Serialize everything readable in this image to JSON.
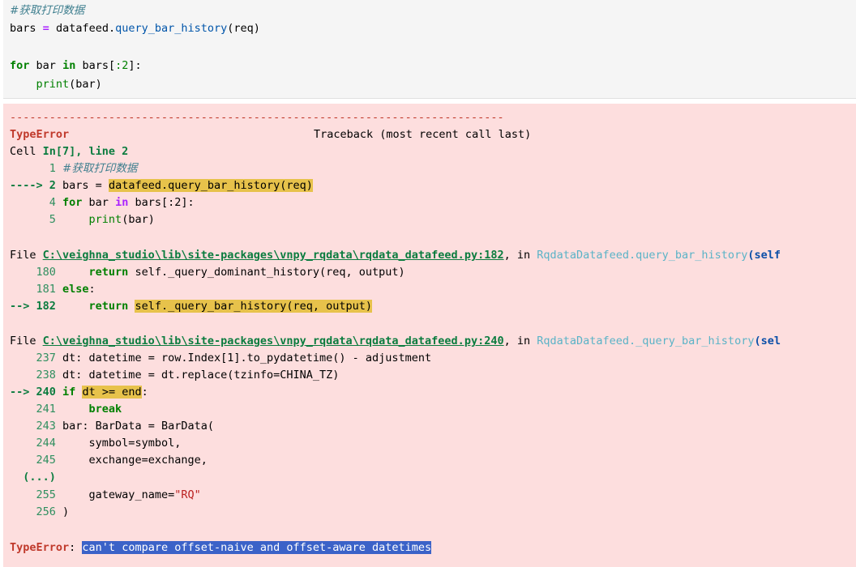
{
  "code_cell": {
    "comment": "#获取打印数据",
    "line2": {
      "var": "bars",
      "eq": "=",
      "obj": "datafeed",
      "method": "query_bar_history",
      "args": "(req)"
    },
    "line4": {
      "kw_for": "for",
      "var": "bar",
      "kw_in": "in",
      "iter": "bars",
      "slice_open": "[",
      "slice_num": ":2",
      "slice_close": "]",
      "colon": ":"
    },
    "line5": {
      "indent": "    ",
      "fn": "print",
      "args": "(bar)"
    }
  },
  "traceback": {
    "dashes": "---------------------------------------------------------------------------",
    "error_name": "TypeError",
    "traceback_label": "Traceback (most recent call last)",
    "cell_prefix": "Cell ",
    "cell_ref": "In[7], line 2",
    "frame1": [
      {
        "marker": "      1",
        "pre": " ",
        "comment": "#获取打印数据"
      },
      {
        "marker": "----> 2",
        "pre": " bars = ",
        "hl": "datafeed.query_bar_history(req)"
      },
      {
        "marker": "      4",
        "kw_for": " for",
        "mid": " bar ",
        "kw_in": "in",
        "post": " bars[:2]:"
      },
      {
        "marker": "      5",
        "fn": "     print",
        "post": "(bar)"
      }
    ],
    "file1": {
      "prefix": "File ",
      "path": "C:\\veighna_studio\\lib\\site-packages\\vnpy_rqdata\\rqdata_datafeed.py:182",
      "in": ", in ",
      "func": "RqdataDatafeed.query_bar_history",
      "paren": "(",
      "self": "self"
    },
    "frame2": [
      {
        "marker": "    180",
        "kw": "     return",
        "post": " self._query_dominant_history(req, output)"
      },
      {
        "marker": "    181",
        "kw": " else",
        "post": ":"
      },
      {
        "marker": "--> 182",
        "kw": "     return",
        "hl": "self._query_bar_history(req, output)"
      }
    ],
    "file2": {
      "prefix": "File ",
      "path": "C:\\veighna_studio\\lib\\site-packages\\vnpy_rqdata\\rqdata_datafeed.py:240",
      "in": ", in ",
      "func": "RqdataDatafeed._query_bar_history",
      "paren": "(",
      "self": "sel"
    },
    "frame3": [
      {
        "marker": "    237",
        "post": " dt: datetime = row.Index[1].to_pydatetime() - adjustment"
      },
      {
        "marker": "    238",
        "post": " dt: datetime = dt.replace(tzinfo=CHINA_TZ)"
      },
      {
        "marker": "--> 240",
        "kw": " if",
        "hl": "dt >= end",
        "post": ":"
      },
      {
        "marker": "    241",
        "kw": "     break",
        "post": ""
      },
      {
        "marker": "    243",
        "post": " bar: BarData = BarData("
      },
      {
        "marker": "    244",
        "post": "     symbol=symbol,"
      },
      {
        "marker": "    245",
        "post": "     exchange=exchange,"
      },
      {
        "marker": "  (...)",
        "post": ""
      },
      {
        "marker": "    255",
        "post": "     gateway_name=",
        "str": "\"RQ\""
      },
      {
        "marker": "    256",
        "post": " )"
      }
    ],
    "final_error": {
      "name": "TypeError",
      "sep": ": ",
      "message": "can't compare offset-naive and offset-aware datetimes"
    }
  }
}
